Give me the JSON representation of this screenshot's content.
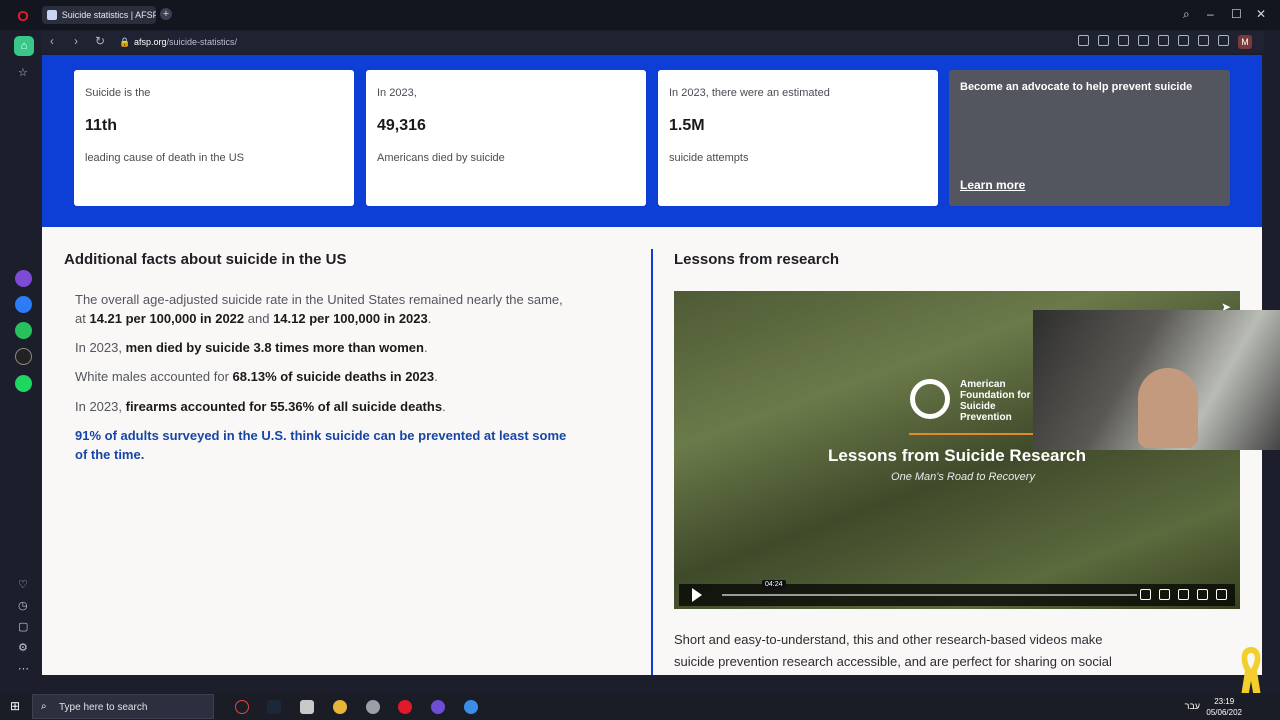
{
  "browser": {
    "tab_title": "Suicide statistics | AFSP",
    "url_domain": "afsp.org",
    "url_path": "/suicide-statistics/",
    "profile_initial": "M"
  },
  "stats": [
    {
      "pre": "Suicide is the",
      "value": "11th",
      "post": "leading cause of death in the US"
    },
    {
      "pre": "In 2023,",
      "value": "49,316",
      "post": "Americans died by suicide"
    },
    {
      "pre": "In 2023, there were an estimated",
      "value": "1.5M",
      "post": "suicide attempts"
    }
  ],
  "cta": {
    "title": "Become an advocate to help prevent suicide",
    "link": "Learn more"
  },
  "facts": {
    "title": "Additional facts about suicide in the US",
    "f1_a": "The overall age-adjusted suicide rate in the United States remained nearly the same, at ",
    "f1_b": "14.21 per 100,000 in 2022",
    "f1_c": " and ",
    "f1_d": "14.12 per 100,000 in 2023",
    "f1_e": ".",
    "f2_a": "In 2023, ",
    "f2_b": "men died by suicide 3.8 times more than women",
    "f2_c": ".",
    "f3_a": "White males accounted for ",
    "f3_b": "68.13% of suicide deaths in 2023",
    "f3_c": ".",
    "f4_a": "In 2023, ",
    "f4_b": "firearms accounted for 55.36% of all suicide deaths",
    "f4_c": ".",
    "f5": "91% of adults surveyed in the U.S. think suicide can be prevented at least some of the time."
  },
  "lessons": {
    "title": "Lessons from research",
    "video_org": "American Foundation for Suicide Prevention",
    "video_title": "Lessons from Suicide Research",
    "video_subtitle": "One Man's Road to Recovery",
    "video_time": "04:24",
    "description": "Short and easy-to-understand, this and other research-based videos make suicide prevention research accessible, and are perfect for sharing on social"
  },
  "taskbar": {
    "search_placeholder": "Type here to search",
    "time": "23:19",
    "date": "05/06/202",
    "lang": "עבר"
  },
  "colors": {
    "brand_blue": "#0d3ed6",
    "link_blue": "#1746a6",
    "cta_gray": "#53565f"
  }
}
